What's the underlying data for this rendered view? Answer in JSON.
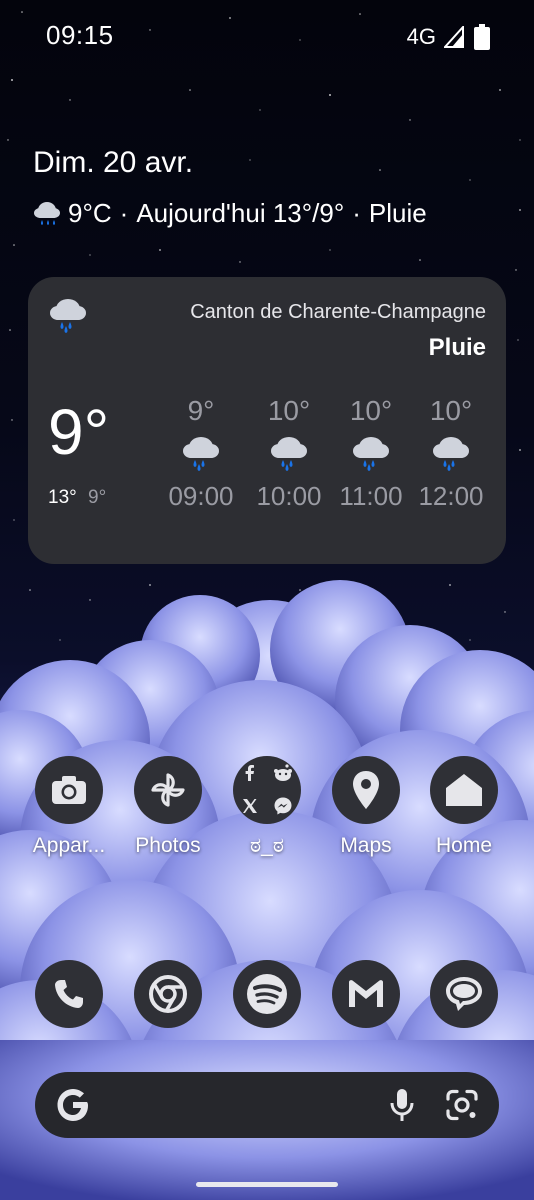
{
  "status_bar": {
    "time": "09:15",
    "network": "4G"
  },
  "at_a_glance": {
    "date": "Dim. 20 avr.",
    "current_temp": "9°C",
    "separator": "·",
    "forecast": "Aujourd'hui 13°/9°",
    "condition": "Pluie"
  },
  "weather_widget": {
    "location": "Canton de Charente-Champagne",
    "condition": "Pluie",
    "current_temp": "9°",
    "high": "13°",
    "low": "9°",
    "hourly": [
      {
        "temp": "9°",
        "time": "09:00",
        "icon": "rain-cloud-icon"
      },
      {
        "temp": "10°",
        "time": "10:00",
        "icon": "rain-cloud-icon"
      },
      {
        "temp": "10°",
        "time": "11:00",
        "icon": "rain-cloud-icon"
      },
      {
        "temp": "10°",
        "time": "12:00",
        "icon": "rain-cloud-icon"
      }
    ]
  },
  "apps_row": [
    {
      "label": "Appar...",
      "icon": "camera-icon"
    },
    {
      "label": "Photos",
      "icon": "pinwheel-icon"
    },
    {
      "label": "ಠ_ಠ",
      "icon": "folder-icon"
    },
    {
      "label": "Maps",
      "icon": "map-pin-icon"
    },
    {
      "label": "Home",
      "icon": "home-icon"
    }
  ],
  "dock": [
    {
      "icon": "phone-icon"
    },
    {
      "icon": "chrome-icon"
    },
    {
      "icon": "spotify-icon"
    },
    {
      "icon": "gmail-icon"
    },
    {
      "icon": "messages-icon"
    }
  ],
  "search_bar": {
    "logo": "google-g-icon",
    "mic": "mic-icon",
    "lens": "lens-icon"
  },
  "colors": {
    "card_bg": "#2d2e33",
    "icon_bg": "#2f3036",
    "rain_drop": "#1a73e8",
    "muted_text": "#9a9ba3"
  }
}
